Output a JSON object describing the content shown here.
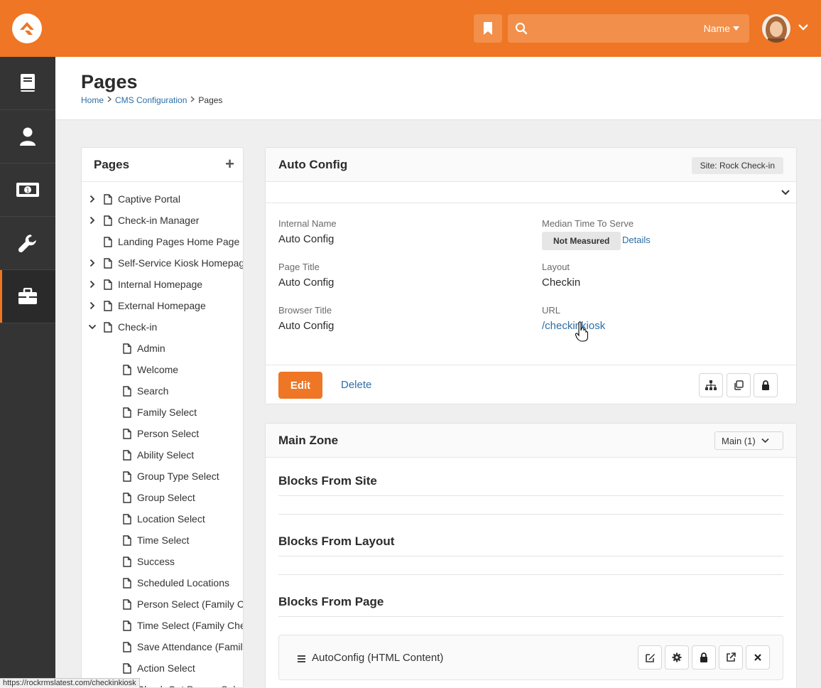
{
  "topbar": {
    "search_type": "Name",
    "search_placeholder": ""
  },
  "sidenav": {
    "items": [
      {
        "icon": "book-icon"
      },
      {
        "icon": "person-icon"
      },
      {
        "icon": "money-icon"
      },
      {
        "icon": "wrench-icon"
      },
      {
        "icon": "briefcase-icon",
        "active": true
      }
    ]
  },
  "header": {
    "title": "Pages",
    "breadcrumb": [
      "Home",
      "CMS Configuration",
      "Pages"
    ]
  },
  "tree": {
    "title": "Pages",
    "add_label": "+",
    "items": [
      {
        "label": "Captive Portal",
        "level": 0,
        "expander": "right"
      },
      {
        "label": "Check-in Manager",
        "level": 0,
        "expander": "right"
      },
      {
        "label": "Landing Pages Home Page",
        "level": 0,
        "expander": ""
      },
      {
        "label": "Self-Service Kiosk Homepage",
        "level": 0,
        "expander": "right"
      },
      {
        "label": "Internal Homepage",
        "level": 0,
        "expander": "right"
      },
      {
        "label": "External Homepage",
        "level": 0,
        "expander": "right"
      },
      {
        "label": "Check-in",
        "level": 0,
        "expander": "down"
      },
      {
        "label": "Admin",
        "level": 1
      },
      {
        "label": "Welcome",
        "level": 1
      },
      {
        "label": "Search",
        "level": 1
      },
      {
        "label": "Family Select",
        "level": 1
      },
      {
        "label": "Person Select",
        "level": 1
      },
      {
        "label": "Ability Select",
        "level": 1
      },
      {
        "label": "Group Type Select",
        "level": 1
      },
      {
        "label": "Group Select",
        "level": 1
      },
      {
        "label": "Location Select",
        "level": 1
      },
      {
        "label": "Time Select",
        "level": 1
      },
      {
        "label": "Success",
        "level": 1
      },
      {
        "label": "Scheduled Locations",
        "level": 1
      },
      {
        "label": "Person Select (Family Check-in)",
        "level": 1
      },
      {
        "label": "Time Select (Family Check-in)",
        "level": 1
      },
      {
        "label": "Save Attendance (Family Check-in)",
        "level": 1
      },
      {
        "label": "Action Select",
        "level": 1
      },
      {
        "label": "Check Out Person Select",
        "level": 1
      }
    ]
  },
  "page_detail": {
    "title": "Auto Config",
    "site_badge": "Site: Rock Check-in",
    "internal_name_label": "Internal Name",
    "internal_name": "Auto Config",
    "page_title_label": "Page Title",
    "page_title": "Auto Config",
    "browser_title_label": "Browser Title",
    "browser_title": "Auto Config",
    "median_label": "Median Time To Serve",
    "median_value": "Not Measured",
    "details_link": "Details",
    "layout_label": "Layout",
    "layout_value": "Checkin",
    "url_label": "URL",
    "url_value": "/checkinkiosk",
    "edit_label": "Edit",
    "delete_label": "Delete"
  },
  "zone": {
    "title": "Main Zone",
    "selected": "Main (1)",
    "site_section": "Blocks From Site",
    "layout_section": "Blocks From Layout",
    "page_section": "Blocks From Page",
    "block_name": "AutoConfig (HTML Content)"
  },
  "status_bar": "https://rockrmslatest.com/checkinkiosk",
  "colors": {
    "accent": "#ee7625",
    "link": "#2d6ea6",
    "sidenav": "#343434"
  }
}
